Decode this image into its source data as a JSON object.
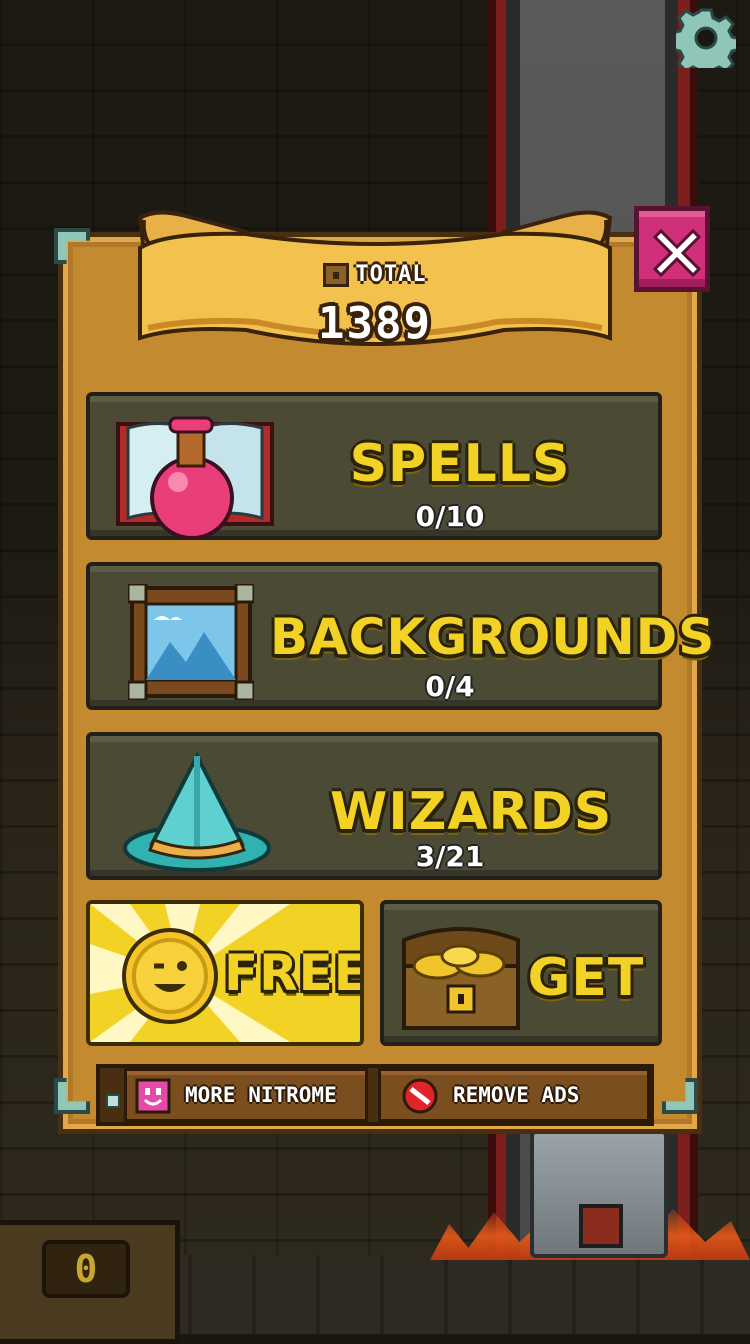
{
  "total": {
    "label": "TOTAL",
    "value": "1389"
  },
  "categories": [
    {
      "title": "SPELLS",
      "count": "0/10",
      "icon": "spell-book-potion-icon"
    },
    {
      "title": "BACKGROUNDS",
      "count": "0/4",
      "icon": "framed-mountain-picture-icon"
    },
    {
      "title": "WIZARDS",
      "count": "3/21",
      "icon": "wizard-hat-icon"
    }
  ],
  "free_button": {
    "label": "FREE",
    "icon": "winking-coin-icon"
  },
  "get_button": {
    "label": "GET",
    "icon": "treasure-chest-gold-icon"
  },
  "links": {
    "more_nitrome": {
      "label": "MORE NITROME",
      "icon": "nitrome-face-icon"
    },
    "remove_ads": {
      "label": "REMOVE ADS",
      "icon": "no-ads-icon"
    }
  },
  "background_chest_counter": "0",
  "colors": {
    "panel": "#c48a30",
    "title_yellow": "#f2d325",
    "close_pink": "#d02f7a",
    "button_dark": "#4b4a35",
    "corner_teal": "#8fc6b8"
  }
}
